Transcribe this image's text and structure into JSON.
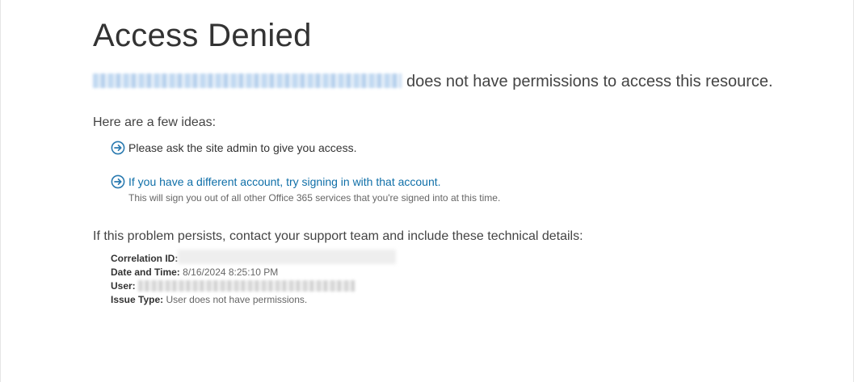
{
  "page": {
    "title": "Access Denied",
    "denied_suffix": "does not have permissions to access this resource.",
    "ideas_heading": "Here are a few ideas:",
    "ideas": [
      {
        "text": "Please ask the site admin to give you access.",
        "icon": "arrow-right-circle-icon"
      },
      {
        "link": "If you have a different account, try signing in with that account.",
        "sub": "This will sign you out of all other Office 365 services that you're signed into at this time.",
        "icon": "arrow-right-circle-icon"
      }
    ],
    "persist_text": "If this problem persists, contact your support team and include these technical details:",
    "details": {
      "correlation_label": "Correlation ID:",
      "date_label": "Date and Time:",
      "date_value": "8/16/2024 8:25:10 PM",
      "user_label": "User:",
      "issue_label": "Issue Type:",
      "issue_value": "User does not have permissions."
    }
  },
  "colors": {
    "link": "#0f6fa8",
    "icon": "#2a7ab0",
    "text": "#333333"
  }
}
